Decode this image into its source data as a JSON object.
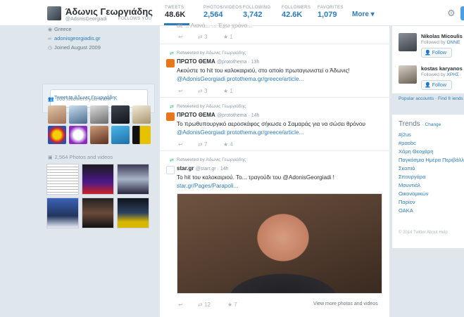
{
  "header": {
    "name": "Άδωνις Γεωργιάδης",
    "handle": "@AdonisGeorgiadi",
    "follows_you": "FOLLOWS YOU",
    "stats": [
      {
        "label": "TWEETS",
        "value": "48.6K"
      },
      {
        "label": "PHOTOS/VIDEOS",
        "value": "2,564"
      },
      {
        "label": "FOLLOWING",
        "value": "3,742"
      },
      {
        "label": "FOLLOWERS",
        "value": "42.6K"
      },
      {
        "label": "FAVORITES",
        "value": "1,079"
      }
    ],
    "more": "More ▾"
  },
  "profile": {
    "location": "Greece",
    "website": "adonisgeorgiadis.gr",
    "joined": "Joined August 2009",
    "tweet_to": "Tweet to Άδωνις Γεωργιάδης",
    "followers_known": "100 followers you know",
    "photos_videos": "2,564 Photos and videos"
  },
  "timeline": {
    "top_fragment": "σε ... Λιανά... ... Έχω χρόνο...",
    "top_actions": {
      "retweets": "3",
      "favorites": "1"
    },
    "tweets": [
      {
        "retweeted_by": "Retweeted by Άδωνις Γεωργιάδης",
        "name": "ΠΡΩΤΟ ΘΕΜΑ",
        "handle": "@protothema · 13h",
        "text": "Ακούστε το hit του καλοκαιριού, στο οποίο πρωταγωνιστεί ο Άδωνις!",
        "link": "@AdonisGeorgiadi protothema.gr/greece/article...",
        "retweets": "3",
        "favorites": "1"
      },
      {
        "retweeted_by": "Retweeted by Άδωνις Γεωργιάδης",
        "name": "ΠΡΩΤΟ ΘΕΜΑ",
        "handle": "@protothema · 14h",
        "text": "Το πρωθυπουργικό αεροσκάφος σήκωσε ο Σαμαράς για να σώσει θρόνου",
        "link": "@AdonisGeorgiadi protothema.gr/greece/article...",
        "retweets": "7",
        "favorites": "4"
      },
      {
        "retweeted_by": "Retweeted by Άδωνις Γεωργιάδης",
        "name": "star.gr",
        "handle": "@starr.gr · 14h",
        "text": "Το hit του καλοκαιριού. Το... τραγούδι του @AdonisGeorgiadi !",
        "link": "star.gr/Pages/Parapoli...",
        "retweets": "12",
        "favorites": "7",
        "more_media": "View more photos and videos"
      }
    ]
  },
  "sidebar": {
    "who_to_follow": [
      {
        "name": "Nikolas Micoulis",
        "followed_by": "Followed by",
        "followed_name": "ONNE",
        "follow": "Follow"
      },
      {
        "name": "kostas karyanos",
        "followed_by": "Followed by",
        "followed_name": "ΧΡΗΣ",
        "follow": "Follow"
      }
    ],
    "links": "Popular accounts · Find fr iends",
    "trends_title": "Trends",
    "trends_change": "· Change",
    "trends": [
      "#j2us",
      "#ραοbc",
      "Χάρη Θεοχάρη",
      "Παγκόσμια Ημέρα Περιβάλλ",
      "Σκοπιό",
      "Σπουργάρα",
      "Μουντιάλ",
      "Οικονομικών",
      "Παρίον",
      "ΟΑΚΑ"
    ],
    "footer": "© 2014 Twitter   About   Help"
  }
}
